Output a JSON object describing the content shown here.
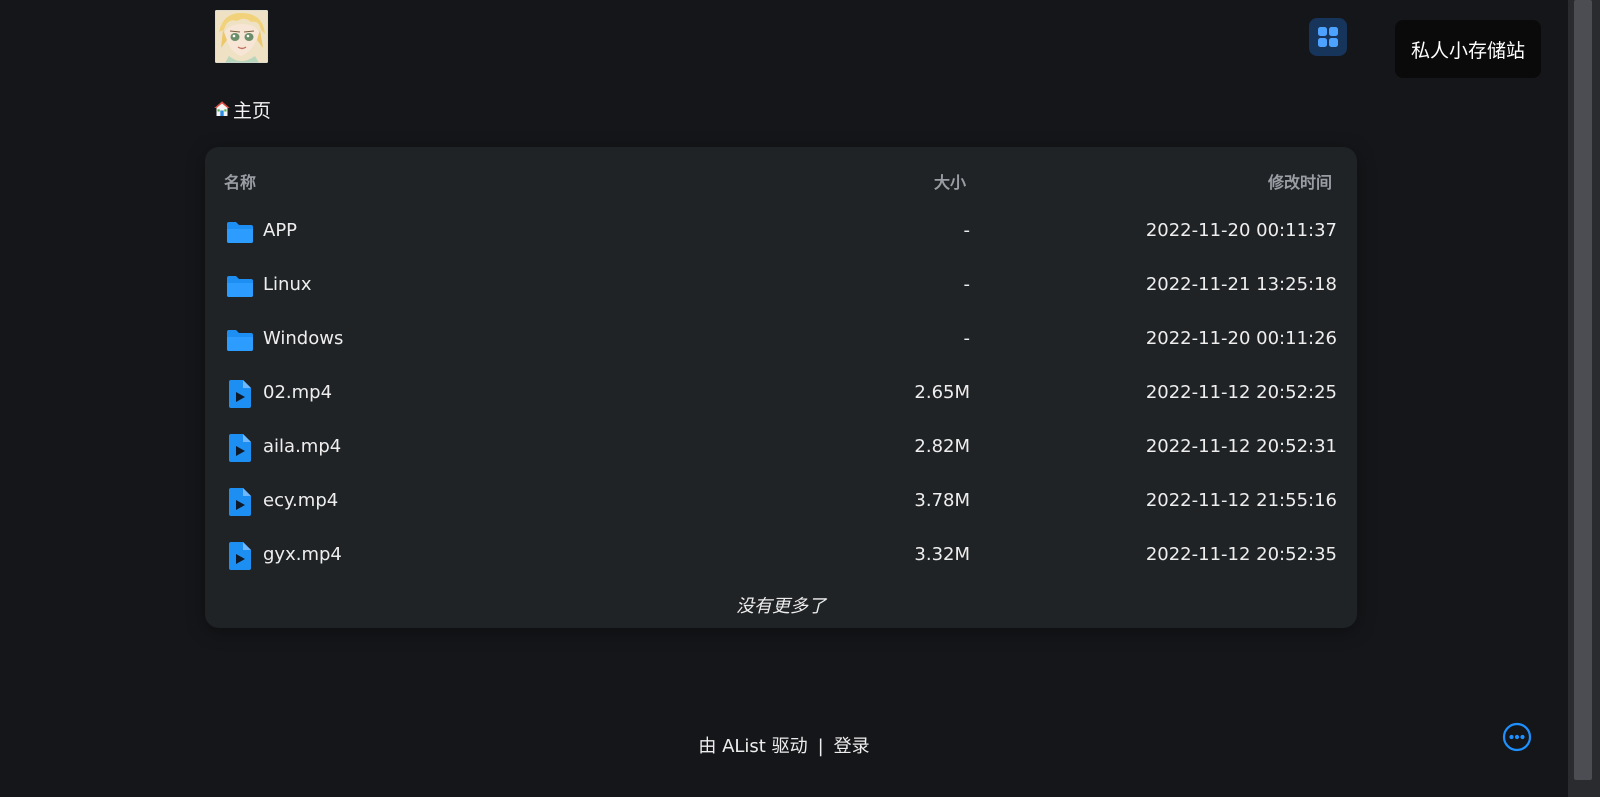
{
  "header": {
    "site_badge": "私人小存储站",
    "avatar_icon": "anime-avatar",
    "layout_toggle_icon": "grid-icon"
  },
  "breadcrumb": {
    "home_label": "主页",
    "home_icon": "house-icon"
  },
  "table": {
    "columns": {
      "name": "名称",
      "size": "大小",
      "modified": "修改时间"
    },
    "rows": [
      {
        "name": "APP",
        "size": "-",
        "modified": "2022-11-20 00:11:37",
        "icon": "folder-icon"
      },
      {
        "name": "Linux",
        "size": "-",
        "modified": "2022-11-21 13:25:18",
        "icon": "folder-icon"
      },
      {
        "name": "Windows",
        "size": "-",
        "modified": "2022-11-20 00:11:26",
        "icon": "folder-icon"
      },
      {
        "name": "02.mp4",
        "size": "2.65M",
        "modified": "2022-11-12 20:52:25",
        "icon": "video-file-icon"
      },
      {
        "name": "aila.mp4",
        "size": "2.82M",
        "modified": "2022-11-12 20:52:31",
        "icon": "video-file-icon"
      },
      {
        "name": "ecy.mp4",
        "size": "3.78M",
        "modified": "2022-11-12 21:55:16",
        "icon": "video-file-icon"
      },
      {
        "name": "gyx.mp4",
        "size": "3.32M",
        "modified": "2022-11-12 20:52:35",
        "icon": "video-file-icon"
      }
    ],
    "end_message": "没有更多了"
  },
  "footer": {
    "powered_by": "由 AList 驱动",
    "separator": "|",
    "login_label": "登录"
  },
  "colors": {
    "background": "#151619",
    "card": "#202326",
    "accent": "#1e90ff",
    "text": "#eeeeee",
    "muted": "#9a9ea4"
  }
}
